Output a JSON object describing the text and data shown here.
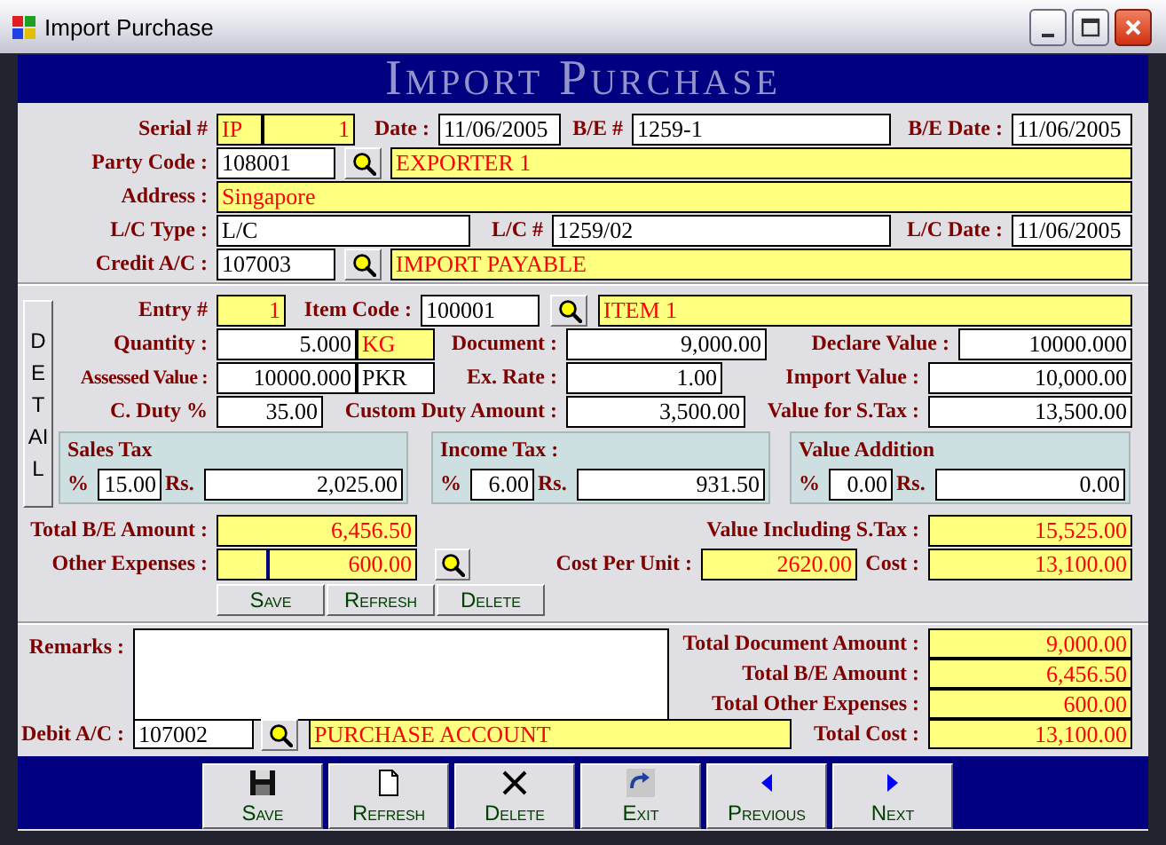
{
  "window": {
    "title": "Import Purchase"
  },
  "banner": {
    "title": "Import Purchase"
  },
  "master": {
    "rows": [
      {
        "fields": [
          {
            "label": "Serial #",
            "controls": [
              {
                "kind": "display",
                "value": "IP"
              },
              {
                "kind": "display",
                "value": "1"
              }
            ]
          },
          {
            "label": "Date :",
            "controls": [
              {
                "kind": "input",
                "value": "11/06/2005"
              }
            ]
          },
          {
            "label": "B/E #",
            "controls": [
              {
                "kind": "input",
                "value": "1259-1"
              }
            ]
          },
          {
            "label": "B/E Date :",
            "controls": [
              {
                "kind": "input",
                "value": "11/06/2005"
              }
            ]
          }
        ]
      },
      {
        "fields": [
          {
            "label": "Party Code :",
            "controls": [
              {
                "kind": "input",
                "value": "108001"
              },
              {
                "kind": "lookup"
              },
              {
                "kind": "display",
                "value": "EXPORTER 1"
              }
            ]
          }
        ]
      },
      {
        "fields": [
          {
            "label": "Address :",
            "controls": [
              {
                "kind": "display",
                "value": "Singapore"
              }
            ]
          }
        ]
      },
      {
        "fields": [
          {
            "label": "L/C Type :",
            "controls": [
              {
                "kind": "input",
                "value": "L/C"
              }
            ]
          },
          {
            "label": "L/C #",
            "controls": [
              {
                "kind": "input",
                "value": "1259/02"
              }
            ]
          },
          {
            "label": "L/C Date :",
            "controls": [
              {
                "kind": "input",
                "value": "11/06/2005"
              }
            ]
          }
        ]
      },
      {
        "fields": [
          {
            "label": "Credit A/C :",
            "controls": [
              {
                "kind": "input",
                "value": "107003"
              },
              {
                "kind": "lookup"
              },
              {
                "kind": "display",
                "value": "IMPORT PAYABLE"
              }
            ]
          }
        ]
      }
    ]
  },
  "detail": {
    "toggle": "DETAIL",
    "rows": [
      {
        "fields": [
          {
            "label": "Entry #",
            "controls": [
              {
                "kind": "display",
                "value": "1"
              }
            ]
          },
          {
            "label": "Item Code :",
            "controls": [
              {
                "kind": "input",
                "value": "100001"
              },
              {
                "kind": "lookup"
              },
              {
                "kind": "display",
                "value": "ITEM 1"
              }
            ]
          }
        ]
      },
      {
        "fields": [
          {
            "label": "Quantity :",
            "controls": [
              {
                "kind": "input",
                "value": "5.000"
              },
              {
                "kind": "display",
                "value": "KG"
              }
            ]
          },
          {
            "label": "Document :",
            "controls": [
              {
                "kind": "input",
                "value": "9,000.00"
              }
            ]
          },
          {
            "label": "Declare Value :",
            "controls": [
              {
                "kind": "input",
                "value": "10000.000"
              }
            ]
          }
        ]
      },
      {
        "fields": [
          {
            "label": "Assessed Value :",
            "controls": [
              {
                "kind": "input",
                "value": "10000.000"
              },
              {
                "kind": "input",
                "value": "PKR"
              }
            ]
          },
          {
            "label": "Ex. Rate :",
            "controls": [
              {
                "kind": "input",
                "value": "1.00"
              }
            ]
          },
          {
            "label": "Import Value :",
            "controls": [
              {
                "kind": "input",
                "value": "10,000.00"
              }
            ]
          }
        ]
      },
      {
        "fields": [
          {
            "label": "C. Duty %",
            "controls": [
              {
                "kind": "input",
                "value": "35.00"
              }
            ]
          },
          {
            "label": "Custom Duty Amount :",
            "controls": [
              {
                "kind": "input",
                "value": "3,500.00"
              }
            ]
          },
          {
            "label": "Value for S.Tax :",
            "controls": [
              {
                "kind": "input",
                "value": "13,500.00"
              }
            ]
          }
        ]
      }
    ],
    "tax_boxes": [
      {
        "title": "Sales Tax",
        "percent_label": "%",
        "percent": "15.00",
        "amount_label": "Rs.",
        "amount": "2,025.00"
      },
      {
        "title": "Income Tax :",
        "percent_label": "%",
        "percent": "6.00",
        "amount_label": "Rs.",
        "amount": "931.50"
      },
      {
        "title": "Value Addition",
        "percent_label": "%",
        "percent": "0.00",
        "amount_label": "Rs.",
        "amount": "0.00"
      }
    ]
  },
  "totals": {
    "rows": [
      {
        "fields": [
          {
            "label": "Total B/E Amount :",
            "controls": [
              {
                "kind": "display",
                "value": "6,456.50"
              }
            ]
          },
          {
            "label": "Value Including S.Tax :",
            "controls": [
              {
                "kind": "display",
                "value": "15,525.00"
              }
            ]
          }
        ]
      },
      {
        "fields": [
          {
            "label": "Other Expenses :",
            "controls": [
              {
                "kind": "display",
                "value": "600.00"
              },
              {
                "kind": "lookup"
              }
            ]
          },
          {
            "label": "Cost Per Unit :",
            "controls": [
              {
                "kind": "display",
                "value": "2620.00"
              }
            ]
          },
          {
            "label": "Cost :",
            "controls": [
              {
                "kind": "display",
                "value": "13,100.00"
              }
            ]
          }
        ]
      }
    ]
  },
  "item_buttons": [
    "Save",
    "Refresh",
    "Delete"
  ],
  "footer": {
    "remarks_label": "Remarks :",
    "summary": [
      {
        "label": "Total Document Amount :",
        "value": "9,000.00"
      },
      {
        "label": "Total B/E Amount :",
        "value": "6,456.50"
      },
      {
        "label": "Total Other Expenses :",
        "value": "600.00"
      }
    ],
    "debit_row": {
      "fields": [
        {
          "label": "Debit A/C :",
          "controls": [
            {
              "kind": "input",
              "value": "107002"
            },
            {
              "kind": "lookup"
            },
            {
              "kind": "display",
              "value": "PURCHASE ACCOUNT"
            }
          ]
        },
        {
          "label": "Total Cost :",
          "controls": [
            {
              "kind": "display",
              "value": "13,100.00"
            }
          ]
        }
      ]
    }
  },
  "nav_buttons": [
    "Save",
    "Refresh",
    "Delete",
    "Exit",
    "Previous",
    "Next"
  ]
}
